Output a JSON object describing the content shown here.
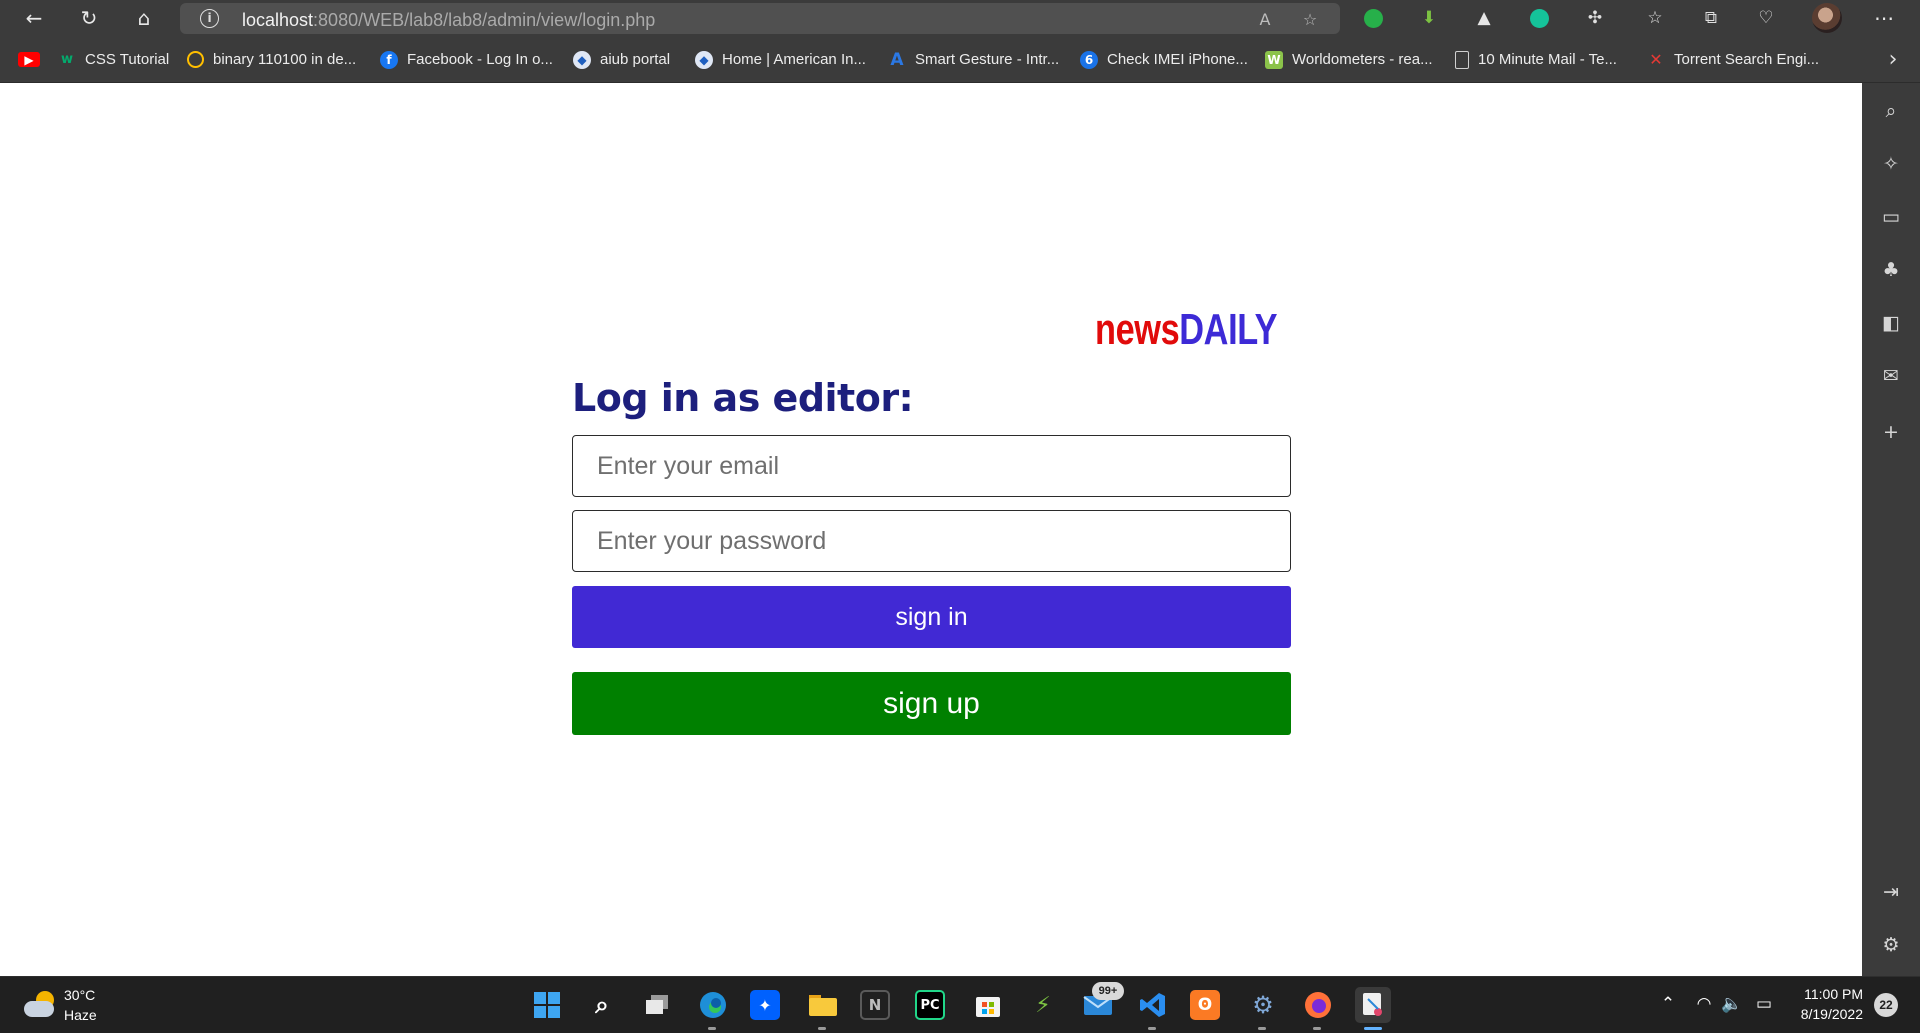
{
  "browser": {
    "url_host": "localhost",
    "url_path": ":8080/WEB/lab8/lab8/admin/view/login.php",
    "bookmarks": [
      {
        "label": "CSS Tutorial",
        "icon": "w3schools-icon",
        "color": "#04aa6d"
      },
      {
        "label": "binary 110100 in de...",
        "icon": "google-icon",
        "color": "#4285f4"
      },
      {
        "label": "Facebook - Log In o...",
        "icon": "facebook-icon",
        "color": "#1877f2"
      },
      {
        "label": "aiub portal",
        "icon": "aiub-shield-icon",
        "color": "#1f5fbf"
      },
      {
        "label": "Home | American In...",
        "icon": "aiub-shield-icon",
        "color": "#1f5fbf"
      },
      {
        "label": "Smart Gesture - Intr...",
        "icon": "asus-icon",
        "color": "#2b78e4"
      },
      {
        "label": "Check IMEI iPhone...",
        "icon": "imei-icon",
        "color": "#1a73e8"
      },
      {
        "label": "Worldometers - rea...",
        "icon": "worldometers-icon",
        "color": "#8bc34a"
      },
      {
        "label": "10 Minute Mail - Te...",
        "icon": "page-icon",
        "color": "#e0e0e0"
      },
      {
        "label": "Torrent Search Engi...",
        "icon": "torrent-icon",
        "color": "#e53935"
      }
    ]
  },
  "page": {
    "logo_news": "news",
    "logo_daily": "DAILY",
    "heading": "Log in as editor:",
    "email_placeholder": "Enter your email",
    "password_placeholder": "Enter your password",
    "signin_label": "sign in",
    "signup_label": "sign up",
    "colors": {
      "logo_news": "#e10b0b",
      "logo_daily": "#3d2ad6",
      "heading": "#1d1f7d",
      "signin_bg": "#4129d4",
      "signup_bg": "#008000"
    }
  },
  "taskbar": {
    "weather_temp": "30°C",
    "weather_condition": "Haze",
    "mail_badge": "99+",
    "time": "11:00 PM",
    "date": "8/19/2022",
    "notification_count": "22"
  }
}
